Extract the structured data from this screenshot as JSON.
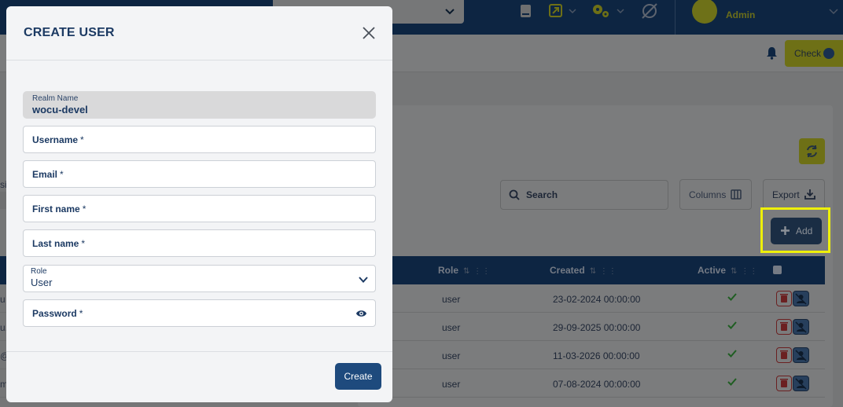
{
  "header": {
    "user_name": "Admin",
    "check_label": "Check"
  },
  "toolbar": {
    "search_placeholder": "Search",
    "columns_label": "Columns",
    "export_label": "Export",
    "add_label": "Add"
  },
  "table": {
    "columns": [
      "Role",
      "Created",
      "Active"
    ],
    "rows": [
      {
        "role": "user",
        "created": "23-02-2024 00:00:00",
        "left": "u"
      },
      {
        "role": "user",
        "created": "29-09-2025 00:00:00",
        "left": "u.c"
      },
      {
        "role": "user",
        "created": "11-03-2026 00:00:00",
        "left": "@"
      },
      {
        "role": "user",
        "created": "07-08-2024 00:00:00",
        "left": "m"
      }
    ],
    "left_fragment_top": "si"
  },
  "modal": {
    "title": "CREATE USER",
    "realm_label": "Realm Name",
    "realm_value": "wocu-devel",
    "fields": {
      "username": "Username",
      "email": "Email",
      "first_name": "First name",
      "last_name": "Last name",
      "password": "Password"
    },
    "required_mark": "*",
    "role_label": "Role",
    "role_value": "User",
    "create_label": "Create"
  },
  "colors": {
    "modal_title": "#1c3a63",
    "primary_button": "#1e4a7d",
    "highlight": "#eef00a",
    "navbar": "#0d2542"
  }
}
